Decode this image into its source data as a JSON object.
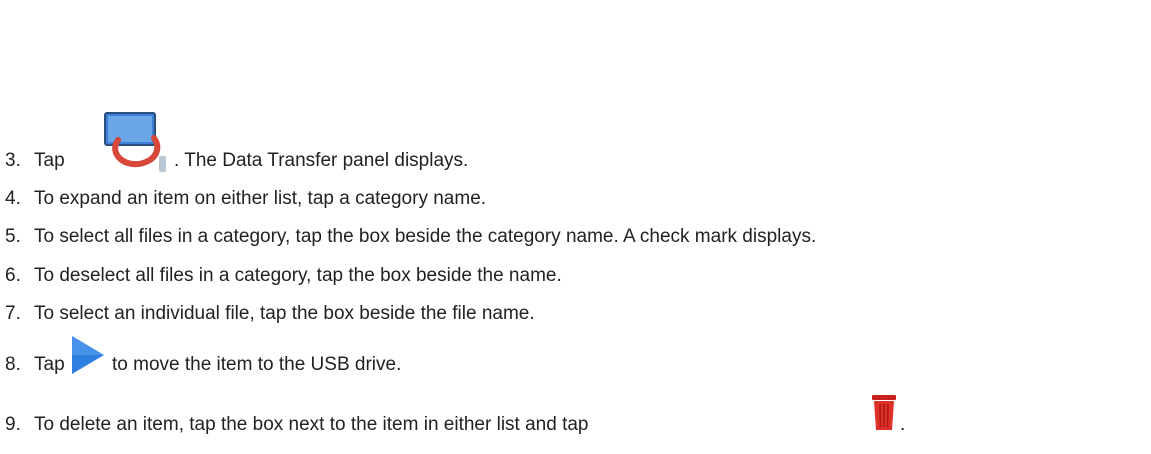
{
  "steps": [
    {
      "number": "3.",
      "before": "Tap",
      "icon": "data-transfer-icon",
      "after": ". The Data Transfer panel displays."
    },
    {
      "number": "4.",
      "text": "To expand an item on either list, tap a category name."
    },
    {
      "number": "5.",
      "text": "To select all files in a category, tap the box beside the category name. A check mark displays."
    },
    {
      "number": "6.",
      "text": "To deselect all files in a category, tap the box beside the name."
    },
    {
      "number": "7.",
      "text": "To select an individual file, tap the box beside the file name."
    },
    {
      "number": "8.",
      "before": "Tap",
      "icon": "play-arrow-icon",
      "after": "to move the item to the USB drive."
    },
    {
      "number": "9.",
      "before": "To delete an item, tap the box next to the item in either list and tap",
      "icon": "trash-icon",
      "after": "."
    }
  ],
  "colors": {
    "text": "#222222",
    "arrow": "#2e7fe0",
    "trash": "#e0302a",
    "cable": "#d7473a",
    "screen": "#4f8fd8"
  }
}
